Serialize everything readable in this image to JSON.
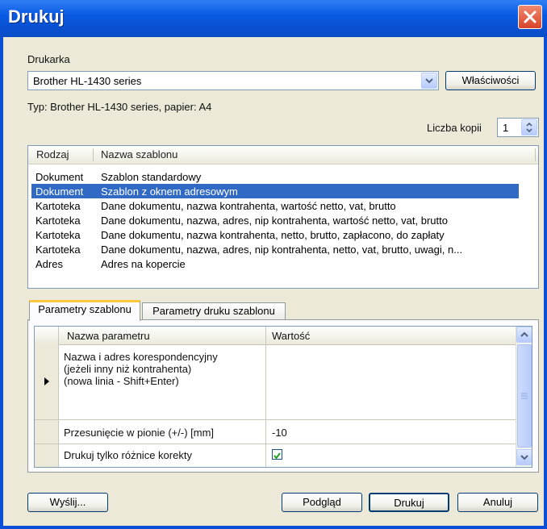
{
  "window": {
    "title": "Drukuj"
  },
  "printer": {
    "label": "Drukarka",
    "selected": "Brother HL-1430 series",
    "properties_button": "Właściwości",
    "type_info": "Typ: Brother HL-1430 series, papier: A4"
  },
  "copies": {
    "label": "Liczba kopii",
    "value": "1"
  },
  "templates": {
    "headers": [
      "Rodzaj",
      "Nazwa szablonu"
    ],
    "rows": [
      {
        "kind": "Dokument",
        "name": "Szablon standardowy"
      },
      {
        "kind": "Dokument",
        "name": "Szablon z oknem adresowym"
      },
      {
        "kind": "Kartoteka",
        "name": "Dane dokumentu, nazwa kontrahenta, wartość netto, vat, brutto"
      },
      {
        "kind": "Kartoteka",
        "name": "Dane dokumentu, nazwa, adres, nip kontrahenta, wartość netto, vat, brutto"
      },
      {
        "kind": "Kartoteka",
        "name": "Dane dokumentu, nazwa kontrahenta, netto, brutto, zapłacono, do zapłaty"
      },
      {
        "kind": "Kartoteka",
        "name": "Dane dokumentu, nazwa, adres, nip kontrahenta, netto, vat, brutto, uwagi, n..."
      },
      {
        "kind": "Adres",
        "name": "Adres na kopercie"
      }
    ],
    "selected_index": 1
  },
  "tabs": [
    {
      "label": "Parametry szablonu",
      "active": true
    },
    {
      "label": "Parametry druku szablonu",
      "active": false
    }
  ],
  "params": {
    "headers": [
      "Nazwa parametru",
      "Wartość"
    ],
    "row1_lines": [
      "Nazwa i adres korespondencyjny",
      "(jeżeli inny niż kontrahenta)",
      "(nowa linia - Shift+Enter)"
    ],
    "row1_value": "",
    "row2_name": "Przesunięcie w pionie (+/-) [mm]",
    "row2_value": "-10",
    "row3_name": "Drukuj tylko różnice korekty",
    "row3_checked": true
  },
  "buttons": {
    "send": "Wyślij...",
    "preview": "Podgląd",
    "print": "Drukuj",
    "cancel": "Anuluj"
  }
}
